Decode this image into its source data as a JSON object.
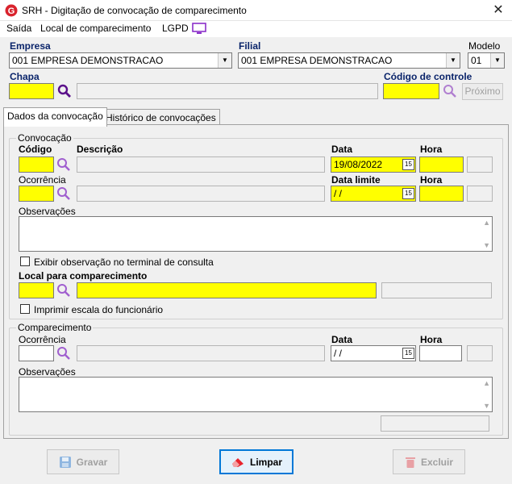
{
  "window": {
    "title": "SRH - Digitação de convocação de comparecimento"
  },
  "menu": {
    "items": [
      "Saída",
      "Local de comparecimento",
      "LGPD"
    ]
  },
  "header": {
    "empresa_label": "Empresa",
    "empresa_value": "001 EMPRESA DEMONSTRACAO",
    "filial_label": "Filial",
    "filial_value": "001 EMPRESA DEMONSTRACAO",
    "modelo_label": "Modelo",
    "modelo_value": "01",
    "chapa_label": "Chapa",
    "chapa_value": "",
    "chapa_desc": "",
    "codigo_controle_label": "Código de controle",
    "codigo_controle_value": "",
    "proximo_label": "Próximo"
  },
  "tabs": [
    {
      "label": "Dados da convocação",
      "active": true
    },
    {
      "label": "Histórico de convocações",
      "active": false
    }
  ],
  "convocacao": {
    "group_title": "Convocação",
    "codigo_label": "Código",
    "descricao_label": "Descrição",
    "data_label": "Data",
    "hora_label": "Hora",
    "codigo_value": "",
    "descricao_value": "",
    "data_value": "19/08/2022",
    "hora_value": "",
    "ocorrencia_label": "Ocorrência",
    "data_limite_label": "Data limite",
    "hora2_label": "Hora",
    "ocorrencia_value": "",
    "ocorrencia_desc": "",
    "data_limite_value": " / /",
    "hora2_value": "",
    "observacoes_label": "Observações",
    "observacoes_value": "",
    "exibir_obs_label": "Exibir observação no terminal de consulta",
    "local_label": "Local para comparecimento",
    "local_codigo": "",
    "local_desc": "",
    "local_extra": "",
    "imprimir_escala_label": "Imprimir escala do funcionário"
  },
  "comparecimento": {
    "group_title": "Comparecimento",
    "ocorrencia_label": "Ocorrência",
    "data_label": "Data",
    "hora_label": "Hora",
    "ocorrencia_value": "",
    "ocorrencia_desc": "",
    "data_value": " / /",
    "hora_value": "",
    "observacoes_label": "Observações",
    "observacoes_value": "",
    "status_value": ""
  },
  "actions": {
    "gravar": "Gravar",
    "limpar": "Limpar",
    "excluir": "Excluir"
  },
  "colors": {
    "yellow_field": "#ffff00",
    "header_blue": "#0a246a",
    "search_purple": "#7b2fa8",
    "primary_border": "#0078d7"
  }
}
